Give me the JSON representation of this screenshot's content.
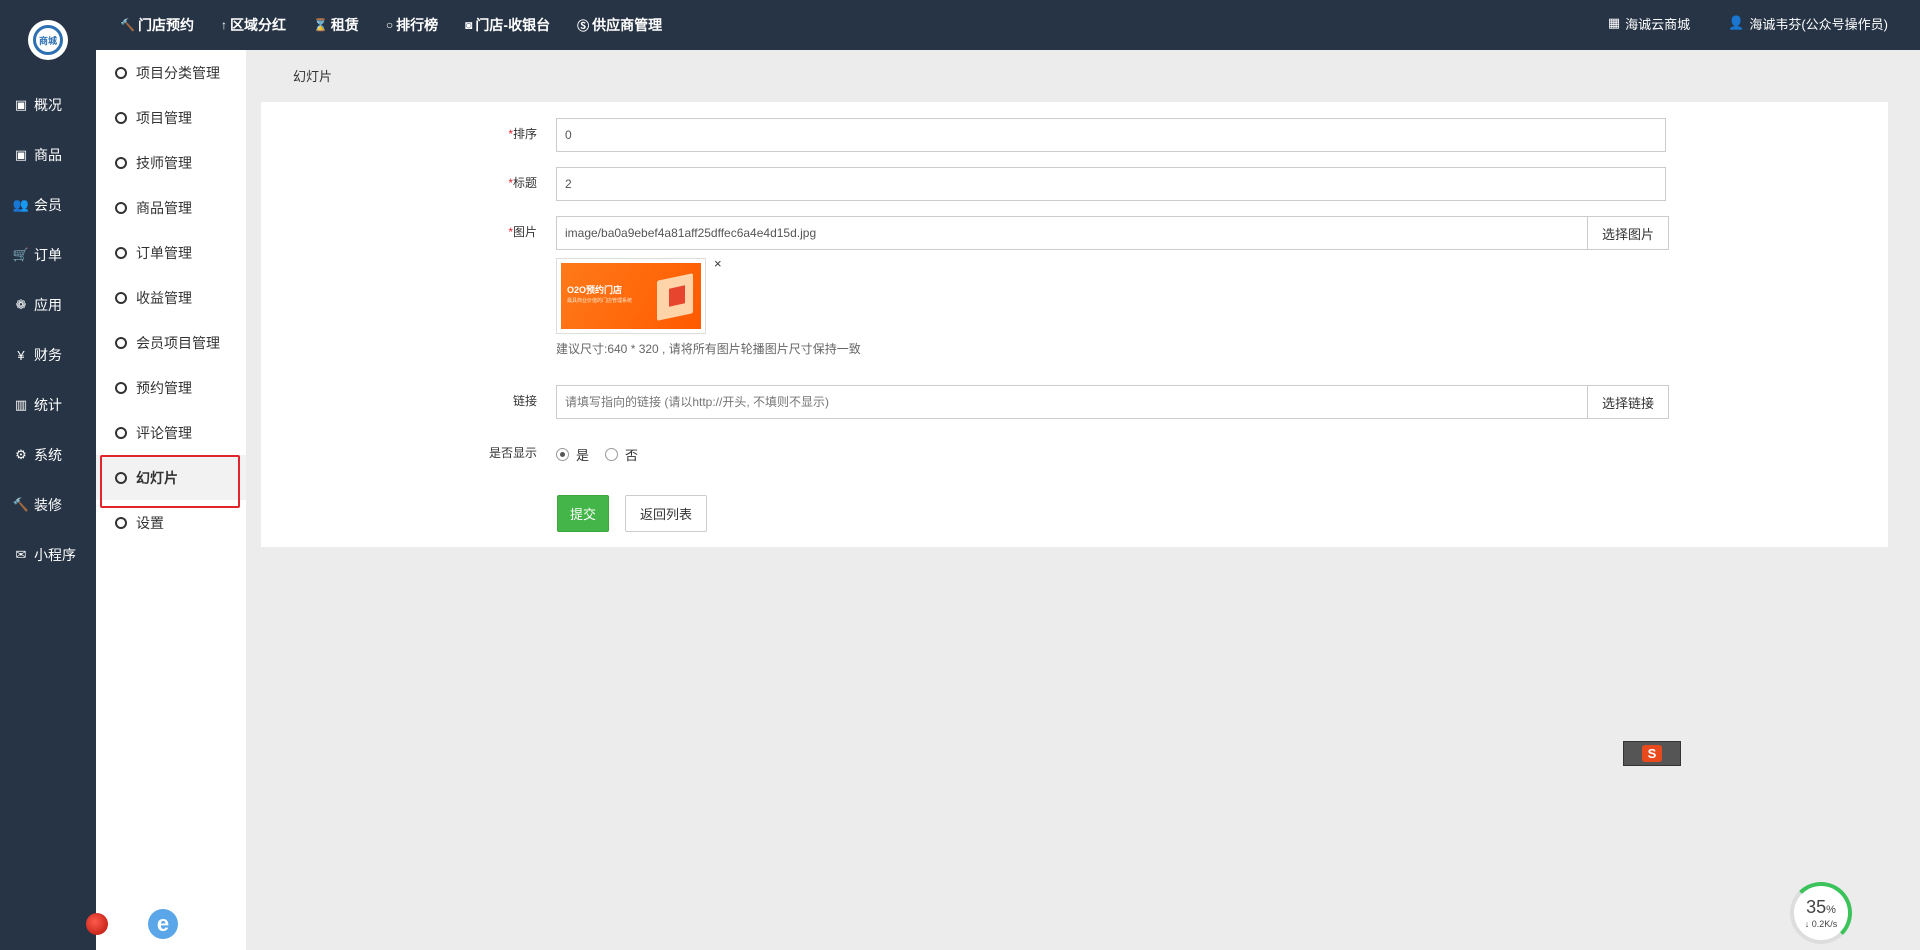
{
  "brand": {
    "logo_text": "商城"
  },
  "main_nav": [
    {
      "icon": "▣",
      "label": "概况"
    },
    {
      "icon": "▣",
      "label": "商品"
    },
    {
      "icon": "👥",
      "label": "会员"
    },
    {
      "icon": "🛒",
      "label": "订单"
    },
    {
      "icon": "❁",
      "label": "应用"
    },
    {
      "icon": "¥",
      "label": "财务"
    },
    {
      "icon": "▥",
      "label": "统计"
    },
    {
      "icon": "⚙",
      "label": "系统"
    },
    {
      "icon": "🔨",
      "label": "装修"
    },
    {
      "icon": "✉",
      "label": "小程序"
    }
  ],
  "top_menu": [
    {
      "icon": "🔨",
      "label": "门店预约"
    },
    {
      "icon": "↑",
      "label": "区域分红"
    },
    {
      "icon": "⌛",
      "label": "租赁"
    },
    {
      "icon": "○",
      "label": "排行榜"
    },
    {
      "icon": "◙",
      "label": "门店-收银台"
    },
    {
      "icon": "Ⓢ",
      "label": "供应商管理"
    }
  ],
  "top_right": {
    "shop": {
      "icon": "▦",
      "label": "海诚云商城"
    },
    "user": {
      "icon": "👤",
      "label": "海诚韦芬(公众号操作员)"
    }
  },
  "sub_nav": [
    "项目分类管理",
    "项目管理",
    "技师管理",
    "商品管理",
    "订单管理",
    "收益管理",
    "会员项目管理",
    "预约管理",
    "评论管理",
    "幻灯片",
    "设置"
  ],
  "breadcrumb": "幻灯片",
  "form": {
    "sort": {
      "label": "排序",
      "required": "*",
      "value": "0"
    },
    "title": {
      "label": "标题",
      "required": "*",
      "value": "2"
    },
    "image": {
      "label": "图片",
      "required": "*",
      "value": "image/ba0a9ebef4a81aff25dffec6a4e4d15d.jpg",
      "button": "选择图片",
      "thumb_title": "O2O预约门店",
      "thumb_subtitle": "最具商业价值的门店管理系统",
      "close": "×",
      "hint": "建议尺寸:640 * 320 , 请将所有图片轮播图片尺寸保持一致"
    },
    "link": {
      "label": "链接",
      "placeholder": "请填写指向的链接 (请以http://开头, 不填则不显示)",
      "button": "选择链接"
    },
    "display": {
      "label": "是否显示",
      "options": [
        "是",
        "否"
      ],
      "selected": "是"
    },
    "submit": "提交",
    "back": "返回列表"
  },
  "widgets": {
    "ime": "S",
    "net_percent": "35",
    "net_percent_unit": "%",
    "net_speed": "↓ 0.2K/s",
    "ie": "e"
  },
  "colors": {
    "sidebar_bg": "#273445",
    "accent_green": "#44b549",
    "required_red": "#e0262a",
    "active_border": "#e0262a"
  }
}
